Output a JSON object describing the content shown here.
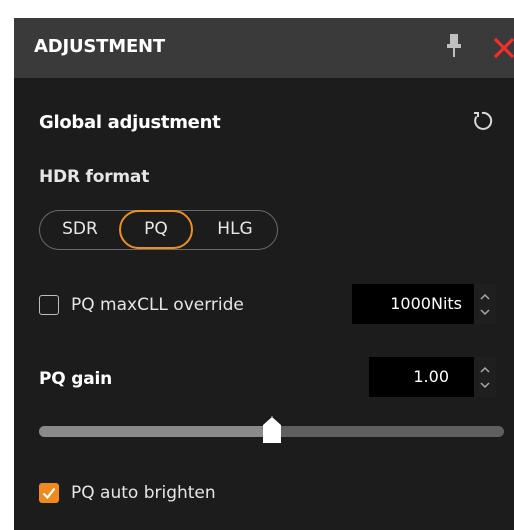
{
  "panel": {
    "title": "ADJUSTMENT",
    "icons": [
      "pin-icon",
      "close-icon"
    ]
  },
  "global": {
    "title": "Global adjustment",
    "reset_icon": "reset-icon"
  },
  "hdr_format": {
    "label": "HDR format",
    "options": [
      "SDR",
      "PQ",
      "HLG"
    ],
    "selected": "PQ"
  },
  "maxcll": {
    "label": "PQ maxCLL override",
    "checked": false,
    "value": "1000Nits"
  },
  "gain": {
    "label": "PQ gain",
    "value": "1.00",
    "slider_level": 0.5
  },
  "auto_brighten": {
    "label": "PQ auto brighten",
    "checked": true
  },
  "colors": {
    "accent": "#ea8f22",
    "close": "#ff2a2a",
    "header_bg": "#3a3a3a",
    "panel_bg": "#1c1c1c"
  }
}
